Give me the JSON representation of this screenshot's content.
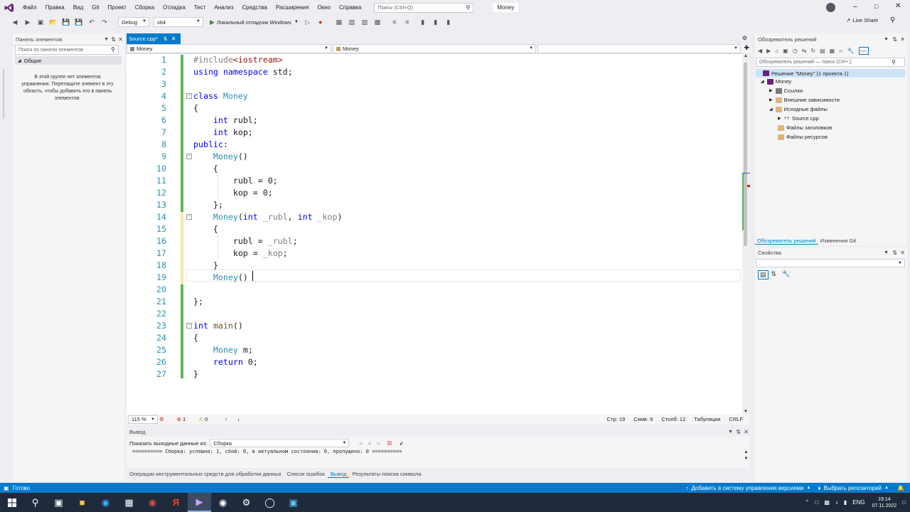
{
  "menu": {
    "items": [
      "Файл",
      "Правка",
      "Вид",
      "Git",
      "Проект",
      "Сборка",
      "Отладка",
      "Тест",
      "Анализ",
      "Средства",
      "Расширения",
      "Окно",
      "Справка"
    ],
    "search_placeholder": "Поиск (Ctrl+Q)",
    "solution_title": "Money",
    "live_share": "Live Share"
  },
  "toolbar": {
    "config": "Debug",
    "platform": "x64",
    "run_label": "Локальный отладчик Windows"
  },
  "toolbox": {
    "title": "Панель элементов",
    "search_placeholder": "Поиск по панели элементов",
    "group": "Общие",
    "empty_text": "В этой группе нет элементов управления. Перетащите элемент в эту область, чтобы добавить его в панель элементов."
  },
  "editor": {
    "tab_label": "Source.cpp*",
    "nav_left": "Money",
    "nav_middle": "Money",
    "zoom": "115 %",
    "errors": "1",
    "warnings": "0",
    "position": {
      "line": "Стр: 19",
      "col": "Симв: 9",
      "chcol": "Столб: 12",
      "tabs": "Табуляция",
      "eol": "CRLF"
    },
    "lines": [
      [
        [
          "inc",
          "#include"
        ],
        [
          "str",
          "<iostream>"
        ]
      ],
      [
        [
          "kw",
          "using"
        ],
        [
          "t",
          " "
        ],
        [
          "kw",
          "namespace"
        ],
        [
          "t",
          " std;"
        ]
      ],
      [],
      [
        [
          "kw",
          "class"
        ],
        [
          "t",
          " "
        ],
        [
          "ty",
          "Money"
        ]
      ],
      [
        [
          "t",
          "{"
        ]
      ],
      [
        [
          "t",
          "    "
        ],
        [
          "kw",
          "int"
        ],
        [
          "t",
          " rubl;"
        ]
      ],
      [
        [
          "t",
          "    "
        ],
        [
          "kw",
          "int"
        ],
        [
          "t",
          " kop;"
        ]
      ],
      [
        [
          "kw",
          "public"
        ],
        [
          "t",
          ":"
        ]
      ],
      [
        [
          "t",
          "    "
        ],
        [
          "ty",
          "Money"
        ],
        [
          "t",
          "()"
        ]
      ],
      [
        [
          "t",
          "    {"
        ]
      ],
      [
        [
          "t",
          "        rubl = 0;"
        ]
      ],
      [
        [
          "t",
          "        kop = 0;"
        ]
      ],
      [
        [
          "t",
          "    };"
        ]
      ],
      [
        [
          "t",
          "    "
        ],
        [
          "ty",
          "Money"
        ],
        [
          "t",
          "("
        ],
        [
          "kw",
          "int"
        ],
        [
          "t",
          " "
        ],
        [
          "pm",
          "_rubl"
        ],
        [
          "t",
          ", "
        ],
        [
          "kw",
          "int"
        ],
        [
          "t",
          " "
        ],
        [
          "pm",
          "_kop"
        ],
        [
          "t",
          ")"
        ]
      ],
      [
        [
          "t",
          "    {"
        ]
      ],
      [
        [
          "t",
          "        rubl = "
        ],
        [
          "pm",
          "_rubl"
        ],
        [
          "t",
          ";"
        ]
      ],
      [
        [
          "t",
          "        kop = "
        ],
        [
          "pm",
          "_kop"
        ],
        [
          "t",
          ";"
        ]
      ],
      [
        [
          "t",
          "    }"
        ]
      ],
      [
        [
          "t",
          "    "
        ],
        [
          "ty",
          "Money"
        ],
        [
          "t",
          "()"
        ]
      ],
      [],
      [
        [
          "t",
          "};"
        ]
      ],
      [],
      [
        [
          "kw",
          "int"
        ],
        [
          "t",
          " "
        ],
        [
          "fn",
          "main"
        ],
        [
          "t",
          "()"
        ]
      ],
      [
        [
          "t",
          "{"
        ]
      ],
      [
        [
          "t",
          "    "
        ],
        [
          "ty",
          "Money"
        ],
        [
          "t",
          " m;"
        ]
      ],
      [
        [
          "t",
          "    "
        ],
        [
          "kw",
          "return"
        ],
        [
          "t",
          " 0;"
        ]
      ],
      [
        [
          "t",
          "}"
        ]
      ]
    ]
  },
  "output": {
    "title": "Вывод",
    "source_label": "Показать выходные данные из:",
    "source_value": "Сборка",
    "text": "========== Сборка: успешно: 1, сбой: 0, в актуальном состоянии: 0, пропущено: 0 ==========",
    "tabs": [
      "Операции инструментальных средств для обработки данных",
      "Список ошибок",
      "Вывод",
      "Результаты поиска символа"
    ]
  },
  "solution_explorer": {
    "title": "Обозреватель решений",
    "search_placeholder": "Обозреватель решений — поиск (Ctrl+;)",
    "items": [
      "Решение \"Money\" (1 проекта 1)",
      "Money",
      "Ссылки",
      "Внешние зависимости",
      "Исходные файлы",
      "Source.cpp",
      "Файлы заголовков",
      "Файлы ресурсов"
    ],
    "tabs": [
      "Обозреватель решений",
      "Изменения Git"
    ]
  },
  "properties": {
    "title": "Свойства"
  },
  "status": {
    "ready": "Готово",
    "vcs": "Добавить в систему управления версиями",
    "repo": "Выбрать репозиторий"
  },
  "taskbar": {
    "lang": "ENG",
    "time": "19:14",
    "date": "07.11.2022"
  },
  "colors": {
    "accent": "#007acc",
    "vs_purple": "#68217a"
  }
}
